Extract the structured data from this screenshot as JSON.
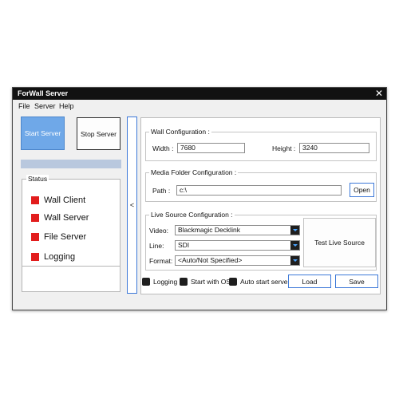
{
  "window": {
    "title": "ForWall Server",
    "close_glyph": "✕"
  },
  "menu": [
    "File",
    "Server",
    "Help"
  ],
  "left": {
    "start_label": "Start Server",
    "stop_label": "Stop Server",
    "progress": 0,
    "status_title": "Status",
    "status_items": [
      "Wall Client",
      "Wall Server",
      "File Server",
      "Logging"
    ],
    "status_color": "#e21d1d"
  },
  "collapse_glyph": "<",
  "wall": {
    "title": "Wall Configuration :",
    "width_label": "Width :",
    "width_value": "7680",
    "height_label": "Height :",
    "height_value": "3240"
  },
  "media": {
    "title": "Media Folder Configuration :",
    "path_label": "Path :",
    "path_value": "c:\\",
    "open_label": "Open"
  },
  "live": {
    "title": "Live Source Configuration :",
    "video_label": "Video:",
    "video_value": "Blackmagic Decklink",
    "line_label": "Line:",
    "line_value": "SDI",
    "format_label": "Format:",
    "format_value": "<Auto/Not Specified>",
    "test_label": "Test Live Source"
  },
  "options": {
    "logging": "Logging",
    "start_os": "Start with OS",
    "auto_start": "Auto start server"
  },
  "actions": {
    "load": "Load",
    "save": "Save"
  },
  "colors": {
    "accent": "#3c78d8",
    "primary_button": "#6fa8e8",
    "titlebar": "#111111"
  }
}
